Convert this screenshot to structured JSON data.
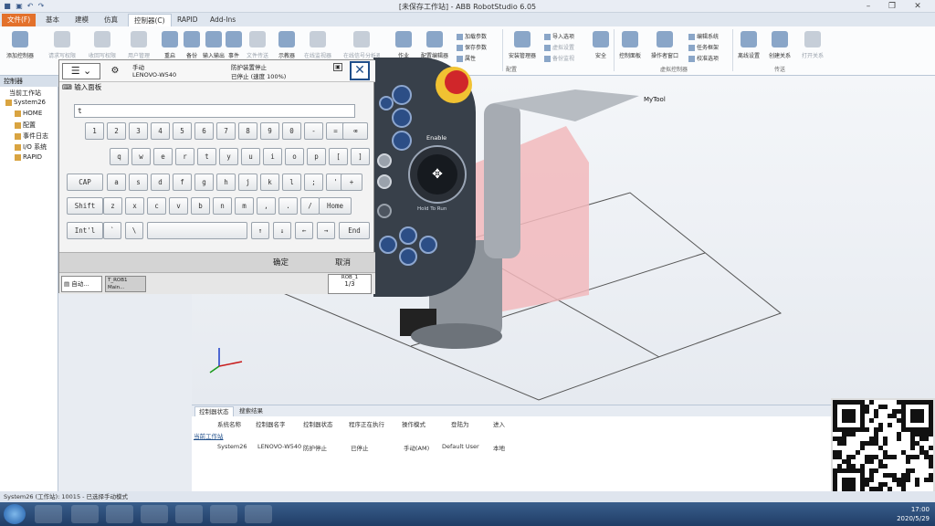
{
  "window": {
    "title": "[未保存工作站] - ABB RobotStudio 6.05"
  },
  "tabs": [
    {
      "label": "文件(F)"
    },
    {
      "label": "基本"
    },
    {
      "label": "建模"
    },
    {
      "label": "仿真"
    },
    {
      "label": "控制器(C)"
    },
    {
      "label": "RAPID"
    },
    {
      "label": "Add-Ins"
    }
  ],
  "ribbon": {
    "buttons": [
      {
        "label": "添加控制器"
      },
      {
        "label": "请求写权限"
      },
      {
        "label": "收回写权限"
      },
      {
        "label": "用户管理"
      },
      {
        "label": "重启"
      },
      {
        "label": "备份"
      },
      {
        "label": "输入输出"
      },
      {
        "label": "事件"
      },
      {
        "label": "文件传送"
      },
      {
        "label": "示教器"
      },
      {
        "label": "在线监视器"
      },
      {
        "label": "在线信号分析器"
      },
      {
        "label": "作业"
      },
      {
        "label": "配置编辑器"
      },
      {
        "label": "安装管理器"
      },
      {
        "label": "安全"
      },
      {
        "label": "控制面板"
      },
      {
        "label": "操作者窗口"
      },
      {
        "label": "离线设置"
      },
      {
        "label": "创建关系"
      },
      {
        "label": "打开关系"
      }
    ],
    "small": [
      {
        "label": "加载参数"
      },
      {
        "label": "保存参数"
      },
      {
        "label": "属性"
      },
      {
        "label": "导入选项"
      },
      {
        "label": "虚拟设置"
      },
      {
        "label": "备份监视"
      },
      {
        "label": "编辑系统"
      },
      {
        "label": "任务框架"
      },
      {
        "label": "校准选项"
      }
    ],
    "groups": [
      {
        "label": "配置"
      },
      {
        "label": "虚拟控制器"
      },
      {
        "label": "传送"
      }
    ]
  },
  "leftpanel": {
    "header": "控制器",
    "items": [
      {
        "label": "当前工作站"
      },
      {
        "label": "System26"
      },
      {
        "label": "HOME"
      },
      {
        "label": "配置"
      },
      {
        "label": "事件日志"
      },
      {
        "label": "I/O 系统"
      },
      {
        "label": "RAPID"
      }
    ]
  },
  "flexpendant": {
    "status_mode": "手动",
    "status_host": "LENOVO-W540",
    "status_state": "防护装置停止",
    "status_speed": "已停止 (速度 100%)",
    "panel_title": "输入面板",
    "input_value": "t",
    "keys_row1": [
      "1",
      "2",
      "3",
      "4",
      "5",
      "6",
      "7",
      "8",
      "9",
      "0",
      "-",
      "="
    ],
    "keys_row2": [
      "q",
      "w",
      "e",
      "r",
      "t",
      "y",
      "u",
      "i",
      "o",
      "p",
      "[",
      "]"
    ],
    "keys_row3": [
      "a",
      "s",
      "d",
      "f",
      "g",
      "h",
      "j",
      "k",
      "l",
      ";",
      "'"
    ],
    "keys_row4": [
      "z",
      "x",
      "c",
      "v",
      "b",
      "n",
      "m",
      ",",
      ".",
      "/"
    ],
    "key_cap": "CAP",
    "key_shift": "Shift",
    "key_intl": "Int'l",
    "key_home": "Home",
    "key_end": "End",
    "key_tick": "`",
    "key_backslash": "\\",
    "key_plus": "+",
    "ok": "确定",
    "cancel": "取消",
    "task1": "自动...",
    "task2_line1": "T_ROB1",
    "task2_line2": "Main...",
    "rob_label": "ROB_1",
    "rob_fraction": "1/3"
  },
  "pendant_hw": {
    "enable_label": "Enable",
    "hold_label": "Hold To Run"
  },
  "viewport": {
    "tool_label": "MyTool"
  },
  "output": {
    "tabs": [
      {
        "label": "控制器状态"
      },
      {
        "label": "搜索结果"
      }
    ],
    "headers": [
      "系统名称",
      "控制器名字",
      "控制器状态",
      "程序正在执行",
      "操作模式",
      "登陆为",
      "进入"
    ],
    "section": "当前工作站",
    "row": [
      "System26",
      "LENOVO-W540",
      "防护停止",
      "已停止",
      "手动(AM)",
      "Default User",
      "本地"
    ]
  },
  "statusbar": {
    "text": "System26 (工作站): 10015 - 已选择手动模式"
  },
  "clock": {
    "time": "17:00",
    "date": "2020/5/29"
  }
}
